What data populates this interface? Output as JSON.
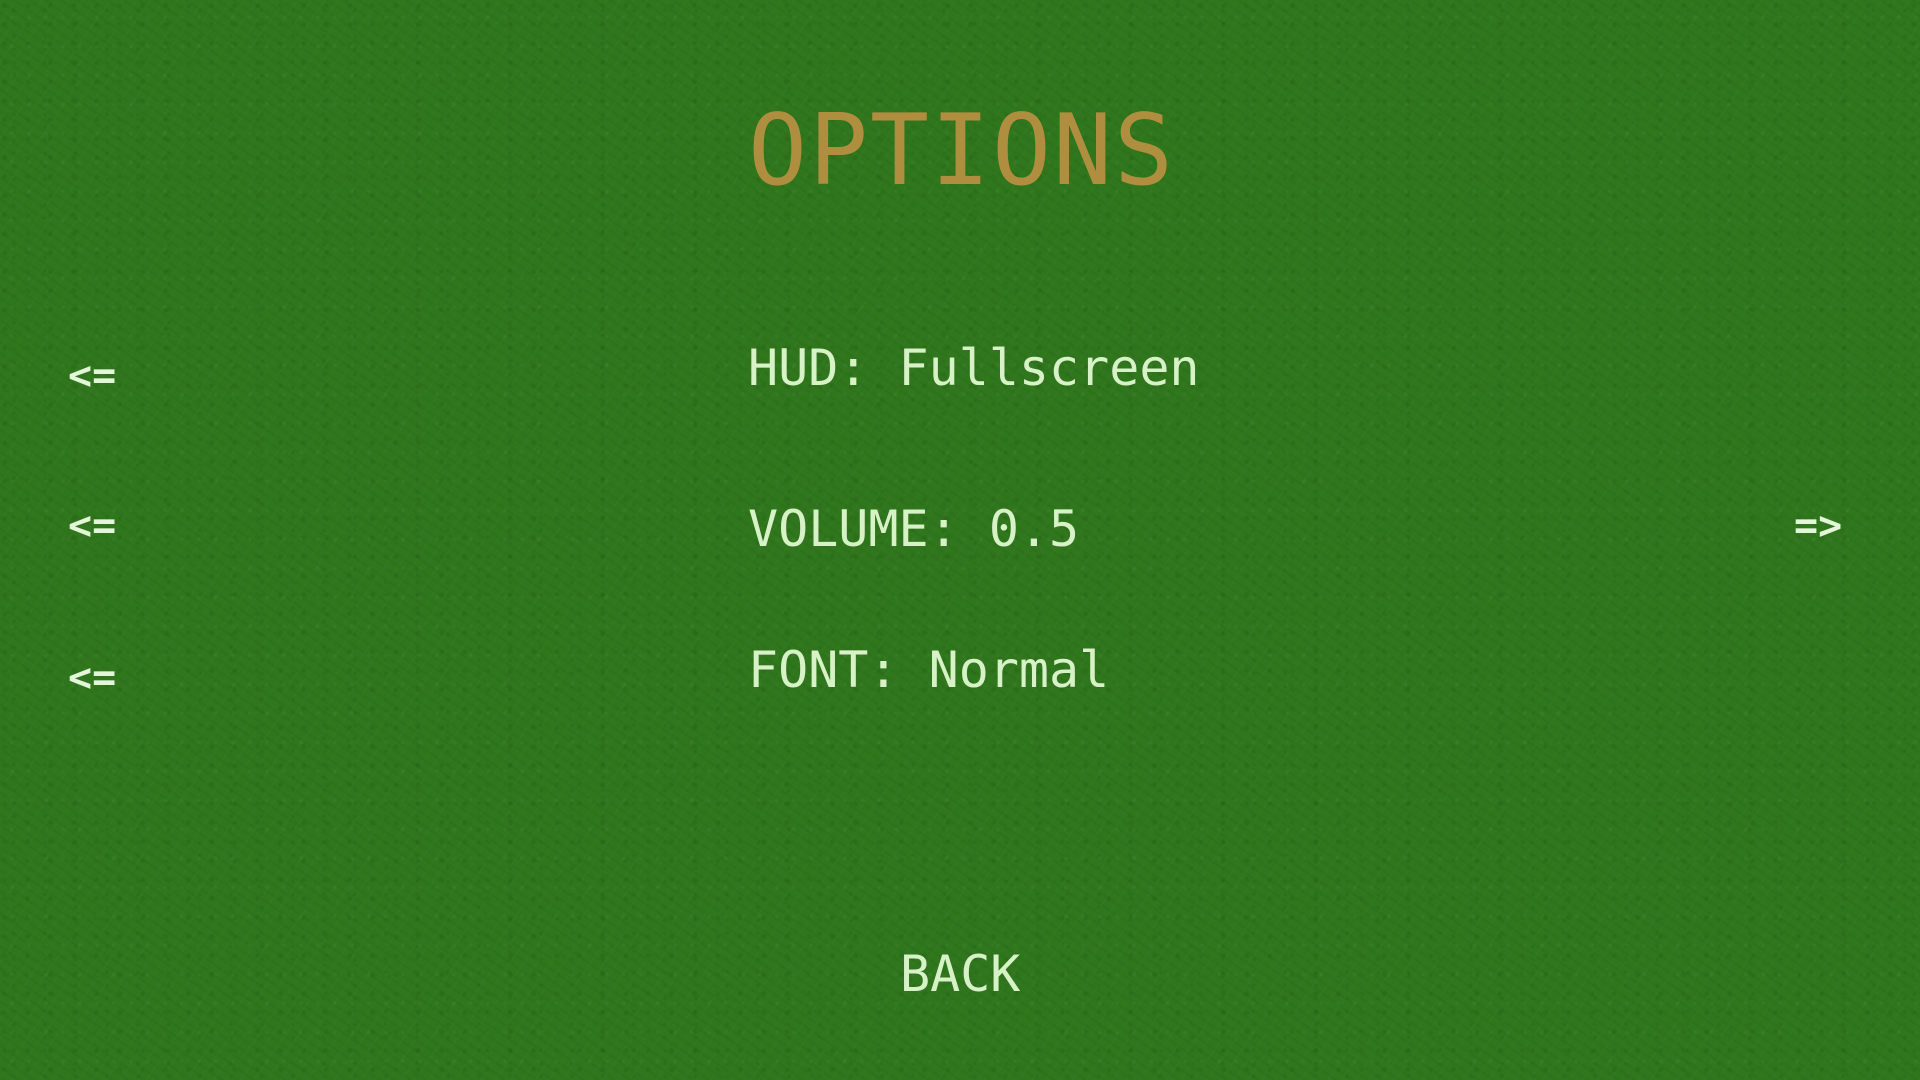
{
  "menu": {
    "title": "OPTIONS",
    "options": [
      {
        "label": "HUD: Fullscreen",
        "left_arrow": "<=",
        "right_arrow": ""
      },
      {
        "label": "VOLUME: 0.5",
        "left_arrow": "<=",
        "right_arrow": "=>"
      },
      {
        "label": "FONT: Normal",
        "left_arrow": "<=",
        "right_arrow": ""
      }
    ],
    "back_label": "BACK"
  },
  "colors": {
    "background": "#2f761c",
    "title": "#b08e40",
    "text": "#d8f2c8"
  }
}
